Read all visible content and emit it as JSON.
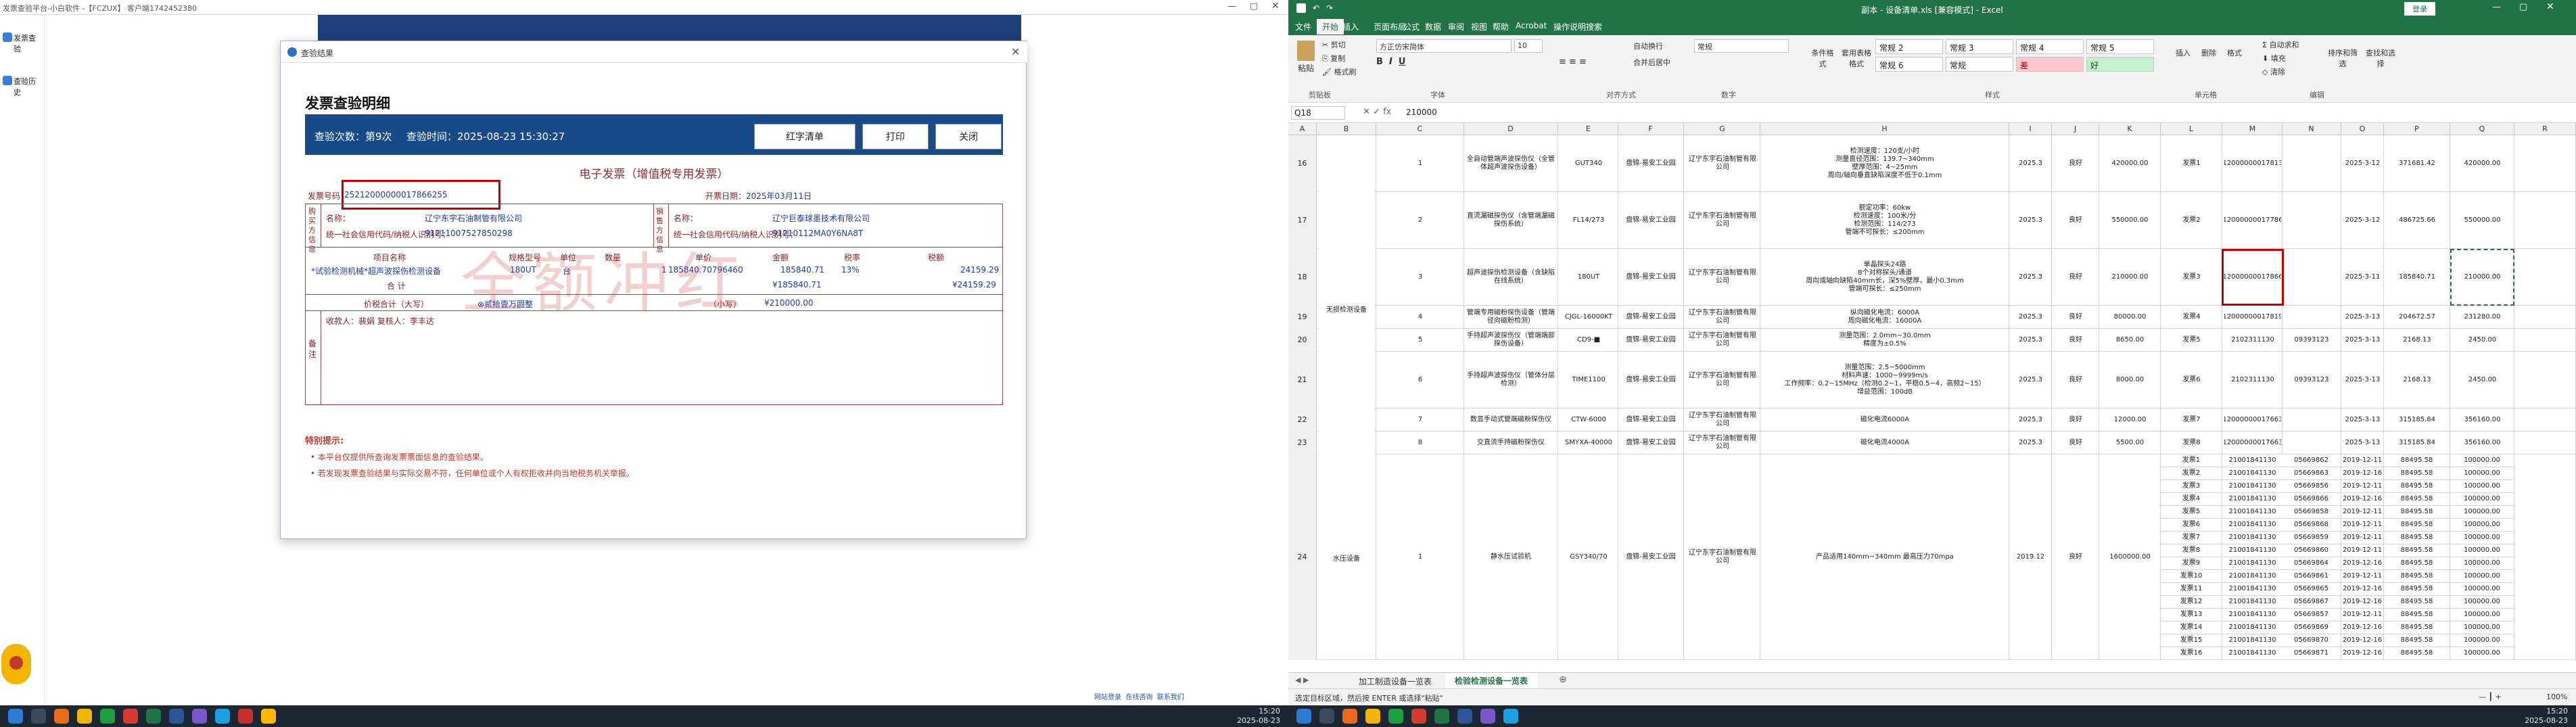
{
  "left_app": {
    "title": "发票查验平台-小白软件 -【FCZUX】 客户端1742452380",
    "sidebar": [
      "发票查验",
      "查验历史"
    ]
  },
  "dialog": {
    "window_title": "查验结果",
    "heading": "发票查验明细",
    "check_count": "查验次数：第9次",
    "check_time": "查验时间：2025-08-23 15:30:27",
    "buttons": [
      "红字清单",
      "打印",
      "关闭"
    ],
    "invoice_title": "电子发票（增值税专用发票）",
    "invoice_no_label": "发票号码：",
    "invoice_no": "25212000000017866255",
    "date_label": "开票日期：",
    "date": "2025年03月11日",
    "buyer_side": "购买方信息",
    "seller_side": "销售方信息",
    "name_label": "名称：",
    "tax_id_label": "统一社会信用代码/纳税人识别号：",
    "buyer_name": "辽宁东宇石油制管有限公司",
    "buyer_tax": "91211007527850298",
    "seller_name": "辽宁巨泰球墨技术有限公司",
    "seller_tax": "91210112MA0Y6NA8T",
    "item_headers": [
      "项目名称",
      "规格型号",
      "单位",
      "数量",
      "单价",
      "金额",
      "税率",
      "税额"
    ],
    "item": {
      "name": "*试验检测机械*超声波探伤检测设备",
      "spec": "180UT",
      "unit": "台",
      "qty": "1",
      "price": "185840.70796460",
      "amount": "185840.71",
      "rate": "13%",
      "tax": "24159.29"
    },
    "total_label": "合    计",
    "total_amount": "¥185840.71",
    "total_tax": "¥24159.29",
    "grand_label": "价税合计（大写）",
    "grand_cn": "⊗贰拾壹万圆整",
    "grand_small_label": "（小写）",
    "grand_small": "¥210000.00",
    "payee": "收款人：裴娟  复核人：李丰达",
    "remark_label": "备注",
    "watermark": "全额冲红",
    "notice_title": "特别提示:",
    "notices": [
      "本平台仅提供所查询发票票面信息的查验结果。",
      "若发现发票查验结果与实际交易不符，任何单位或个人有权拒收并向当地税务机关举报。"
    ]
  },
  "left_taskbar": {
    "time": "15:20",
    "date": "2025-08-23",
    "status": [
      "网站登录",
      "在线咨询",
      "联系我们"
    ]
  },
  "excel": {
    "title": "副本 - 设备清单.xls [兼容模式] - Excel",
    "login": "登录",
    "tabs": [
      "文件",
      "开始",
      "插入",
      "页面布局",
      "公式",
      "数据",
      "审阅",
      "视图",
      "帮助",
      "Acrobat",
      "操作说明搜索"
    ],
    "clipboard": [
      "剪切",
      "复制",
      "格式刷",
      "粘贴"
    ],
    "font_name": "方正仿宋简体",
    "font_size": "10",
    "number_format": "常规",
    "wrap": "自动换行",
    "merge": "合并后居中",
    "groups": [
      "剪贴板",
      "字体",
      "对齐方式",
      "数字",
      "样式",
      "单元格",
      "编辑"
    ],
    "styles": [
      {
        "label": "常规 2"
      },
      {
        "label": "常规 3"
      },
      {
        "label": "常规 4"
      },
      {
        "label": "常规 5"
      },
      {
        "label": "常规 6"
      },
      {
        "label": "常规"
      },
      {
        "label": "差"
      },
      {
        "label": "好"
      }
    ],
    "style_buttons": [
      "条件格式",
      "套用表格格式"
    ],
    "cell_buttons": [
      "插入",
      "删除",
      "格式"
    ],
    "edit_buttons": [
      "自动求和",
      "填充",
      "清除",
      "排序和筛选",
      "查找和选择"
    ],
    "name_box": "Q18",
    "formula": "210000",
    "col_headers": [
      "A",
      "B",
      "C",
      "D",
      "E",
      "F",
      "G",
      "H",
      "I",
      "J",
      "K",
      "L",
      "M",
      "N",
      "O",
      "P",
      "Q",
      "R"
    ],
    "row_nums": [
      "16",
      "17",
      "18",
      "19",
      "20",
      "21",
      "22",
      "23",
      "24"
    ],
    "rows": [
      {
        "num": "16",
        "no": "1",
        "name": "全自动管端声波探伤仪（全管体超声波探伤设备）",
        "model": "GUT340",
        "area": "盘锦-易安工业园",
        "mfr": "辽宁东宇石油制管有限公司",
        "param": "检测速度：120支/小时\n测量直径范围：139.7~340mm\n壁厚范围：4~25mm\n周向/轴向垂直缺陷深度不低于0.1mm",
        "year": "2025.3",
        "state": "良好",
        "price": "420000.00",
        "src": "发票1",
        "inv": "25212000000017813451",
        "date": "2025-3-12",
        "net": "371681.42",
        "total": "420000.00"
      },
      {
        "num": "17",
        "no": "2",
        "name": "直流漏磁探伤仪（含管端漏磁探伤系统）",
        "model": "FL14/273",
        "area": "盘锦-易安工业园",
        "mfr": "辽宁东宇石油制管有限公司",
        "param": "额定功率：60kw\n检测速度：100米/分\n检测范围：114/273\n管端不可探长：≤200mm",
        "year": "2025.3",
        "state": "良好",
        "price": "550000.00",
        "src": "发票2",
        "inv": "25212000000017786394",
        "date": "2025-3-12",
        "net": "486725.66",
        "total": "550000.00"
      },
      {
        "num": "18",
        "no": "3",
        "name": "超声波探伤检测设备（含缺陷在线系统）",
        "model": "180UT",
        "area": "盘锦-易安工业园",
        "mfr": "辽宁东宇石油制管有限公司",
        "param": "单晶探头24路\n8个对称探头/通道\n周向或轴向缺陷40mm长，深5%壁厚，最小0.3mm\n管端可探长：≤250mm",
        "year": "2025.3",
        "state": "良好",
        "price": "210000.00",
        "src": "发票3",
        "inv": "25212000000017866255",
        "date": "2025-3-11",
        "net": "185840.71",
        "total": "210000.00"
      },
      {
        "num": "19",
        "no": "4",
        "name": "管端专用磁粉探伤设备（管端径向磁粉检测）",
        "model": "CJGL-16000KT",
        "area": "盘锦-易安工业园",
        "mfr": "辽宁东宇石油制管有限公司",
        "param": "纵向磁化电流：6000A\n周向磁化电流：16000A",
        "year": "2025.3",
        "state": "良好",
        "price": "80000.00",
        "src": "发票4",
        "inv": "25212000000017819873",
        "date": "2025-3-13",
        "net": "204672.57",
        "total": "231280.00"
      },
      {
        "num": "20",
        "no": "5",
        "name": "手持超声波探伤仪（管端端部探伤设备）",
        "model": "CD9-■",
        "area": "盘锦-易安工业园",
        "mfr": "辽宁东宇石油制管有限公司",
        "param": "测量范围：2.0mm~30.0mm\n精度为±0.5%",
        "year": "2025.3",
        "state": "良好",
        "price": "8650.00",
        "src": "发票5",
        "inv": "2102311130",
        "code": "09393123",
        "date": "2025-3-13",
        "net": "2168.13",
        "total": "2450.00"
      },
      {
        "num": "21",
        "no": "6",
        "name": "手持超声波探伤仪（管体分层检测）",
        "model": "TIME1100",
        "area": "盘锦-易安工业园",
        "mfr": "辽宁东宇石油制管有限公司",
        "param": "测量范围：2.5~5000mm\n材料声速：1000~9999m/s\n工作频率：0.2~15MHz（检测0.2~1，平稳0.5~4，高频2~15）\n增益范围：100dB",
        "year": "2025.3",
        "state": "良好",
        "price": "8000.00",
        "src": "发票6",
        "inv": "2102311130",
        "code": "09393123",
        "date": "2025-3-13",
        "net": "2168.13",
        "total": "2450.00"
      },
      {
        "num": "22",
        "no": "7",
        "name": "数显手动式管端磁粉探伤仪",
        "model": "CTW-6000",
        "area": "盘锦-易安工业园",
        "mfr": "辽宁东宇石油制管有限公司",
        "param": "磁化电流6000A",
        "year": "2025.3",
        "state": "良好",
        "price": "12000.00",
        "src": "发票7",
        "inv": "25212000000017663126",
        "date": "2025-3-13",
        "net": "315185.84",
        "total": "356160.00"
      },
      {
        "num": "23",
        "no": "8",
        "name": "交直流手持磁粉探伤仪",
        "model": "SMYXA-40000",
        "area": "盘锦-易安工业园",
        "mfr": "辽宁东宇石油制管有限公司",
        "param": "磁化电流4000A",
        "year": "2025.3",
        "state": "良好",
        "price": "5500.00",
        "src": "发票8",
        "inv": "25212000000017663126",
        "date": "2025-3-13",
        "net": "315185.84",
        "total": "356160.00"
      },
      {
        "num": "24",
        "no": "1",
        "name": "静水压试验机",
        "model": "GSY340/70",
        "area": "盘锦-易安工业园",
        "mfr": "辽宁东宇石油制管有限公司",
        "param": "产品适用140mm~340mm 最高压力70mpa",
        "year": "2019.12",
        "state": "良好",
        "price": "1600000.00"
      }
    ],
    "category_a": "无损检测设备",
    "category_b": "水压设备",
    "sub_invoices": [
      {
        "src": "发票1",
        "inv": "21001841130",
        "code": "05669862",
        "date": "2019-12-11",
        "net": "88495.58",
        "total": "100000.00"
      },
      {
        "src": "发票2",
        "inv": "21001841130",
        "code": "05669863",
        "date": "2019-12-16",
        "net": "88495.58",
        "total": "100000.00"
      },
      {
        "src": "发票3",
        "inv": "21001841130",
        "code": "05669856",
        "date": "2019-12-11",
        "net": "88495.58",
        "total": "100000.00"
      },
      {
        "src": "发票4",
        "inv": "21001841130",
        "code": "05669866",
        "date": "2019-12-16",
        "net": "88495.58",
        "total": "100000.00"
      },
      {
        "src": "发票5",
        "inv": "21001841130",
        "code": "05669858",
        "date": "2019-12-11",
        "net": "88495.58",
        "total": "100000.00"
      },
      {
        "src": "发票6",
        "inv": "21001841130",
        "code": "05669868",
        "date": "2019-12-11",
        "net": "88495.58",
        "total": "100000.00"
      },
      {
        "src": "发票7",
        "inv": "21001841130",
        "code": "05669859",
        "date": "2019-12-11",
        "net": "88495.58",
        "total": "100000.00"
      },
      {
        "src": "发票8",
        "inv": "21001841130",
        "code": "05669860",
        "date": "2019-12-11",
        "net": "88495.58",
        "total": "100000.00"
      },
      {
        "src": "发票9",
        "inv": "21001841130",
        "code": "05669864",
        "date": "2019-12-16",
        "net": "88495.58",
        "total": "100000.00"
      },
      {
        "src": "发票10",
        "inv": "21001841130",
        "code": "05669861",
        "date": "2019-12-11",
        "net": "88495.58",
        "total": "100000.00"
      },
      {
        "src": "发票11",
        "inv": "21001841130",
        "code": "05669865",
        "date": "2019-12-16",
        "net": "88495.58",
        "total": "100000.00"
      },
      {
        "src": "发票12",
        "inv": "21001841130",
        "code": "05669867",
        "date": "2019-12-16",
        "net": "88495.58",
        "total": "100000.00"
      },
      {
        "src": "发票13",
        "inv": "21001841130",
        "code": "05669857",
        "date": "2019-12-11",
        "net": "88495.58",
        "total": "100000.00"
      },
      {
        "src": "发票14",
        "inv": "21001841130",
        "code": "05669869",
        "date": "2019-12-16",
        "net": "88495.58",
        "total": "100000.00"
      },
      {
        "src": "发票15",
        "inv": "21001841130",
        "code": "05669870",
        "date": "2019-12-16",
        "net": "88495.58",
        "total": "100000.00"
      },
      {
        "src": "发票16",
        "inv": "21001841130",
        "code": "05669871",
        "date": "2019-12-16",
        "net": "88495.58",
        "total": "100000.00"
      }
    ],
    "sheets": [
      "加工制造设备一览表",
      "检验检测设备一览表"
    ],
    "status_left": "选定目标区域，然后按 ENTER 或选择\"粘贴\"",
    "zoom": "100%",
    "taskbar_time": "15:20",
    "taskbar_date": "2025-08-23",
    "accent": "#217346"
  }
}
